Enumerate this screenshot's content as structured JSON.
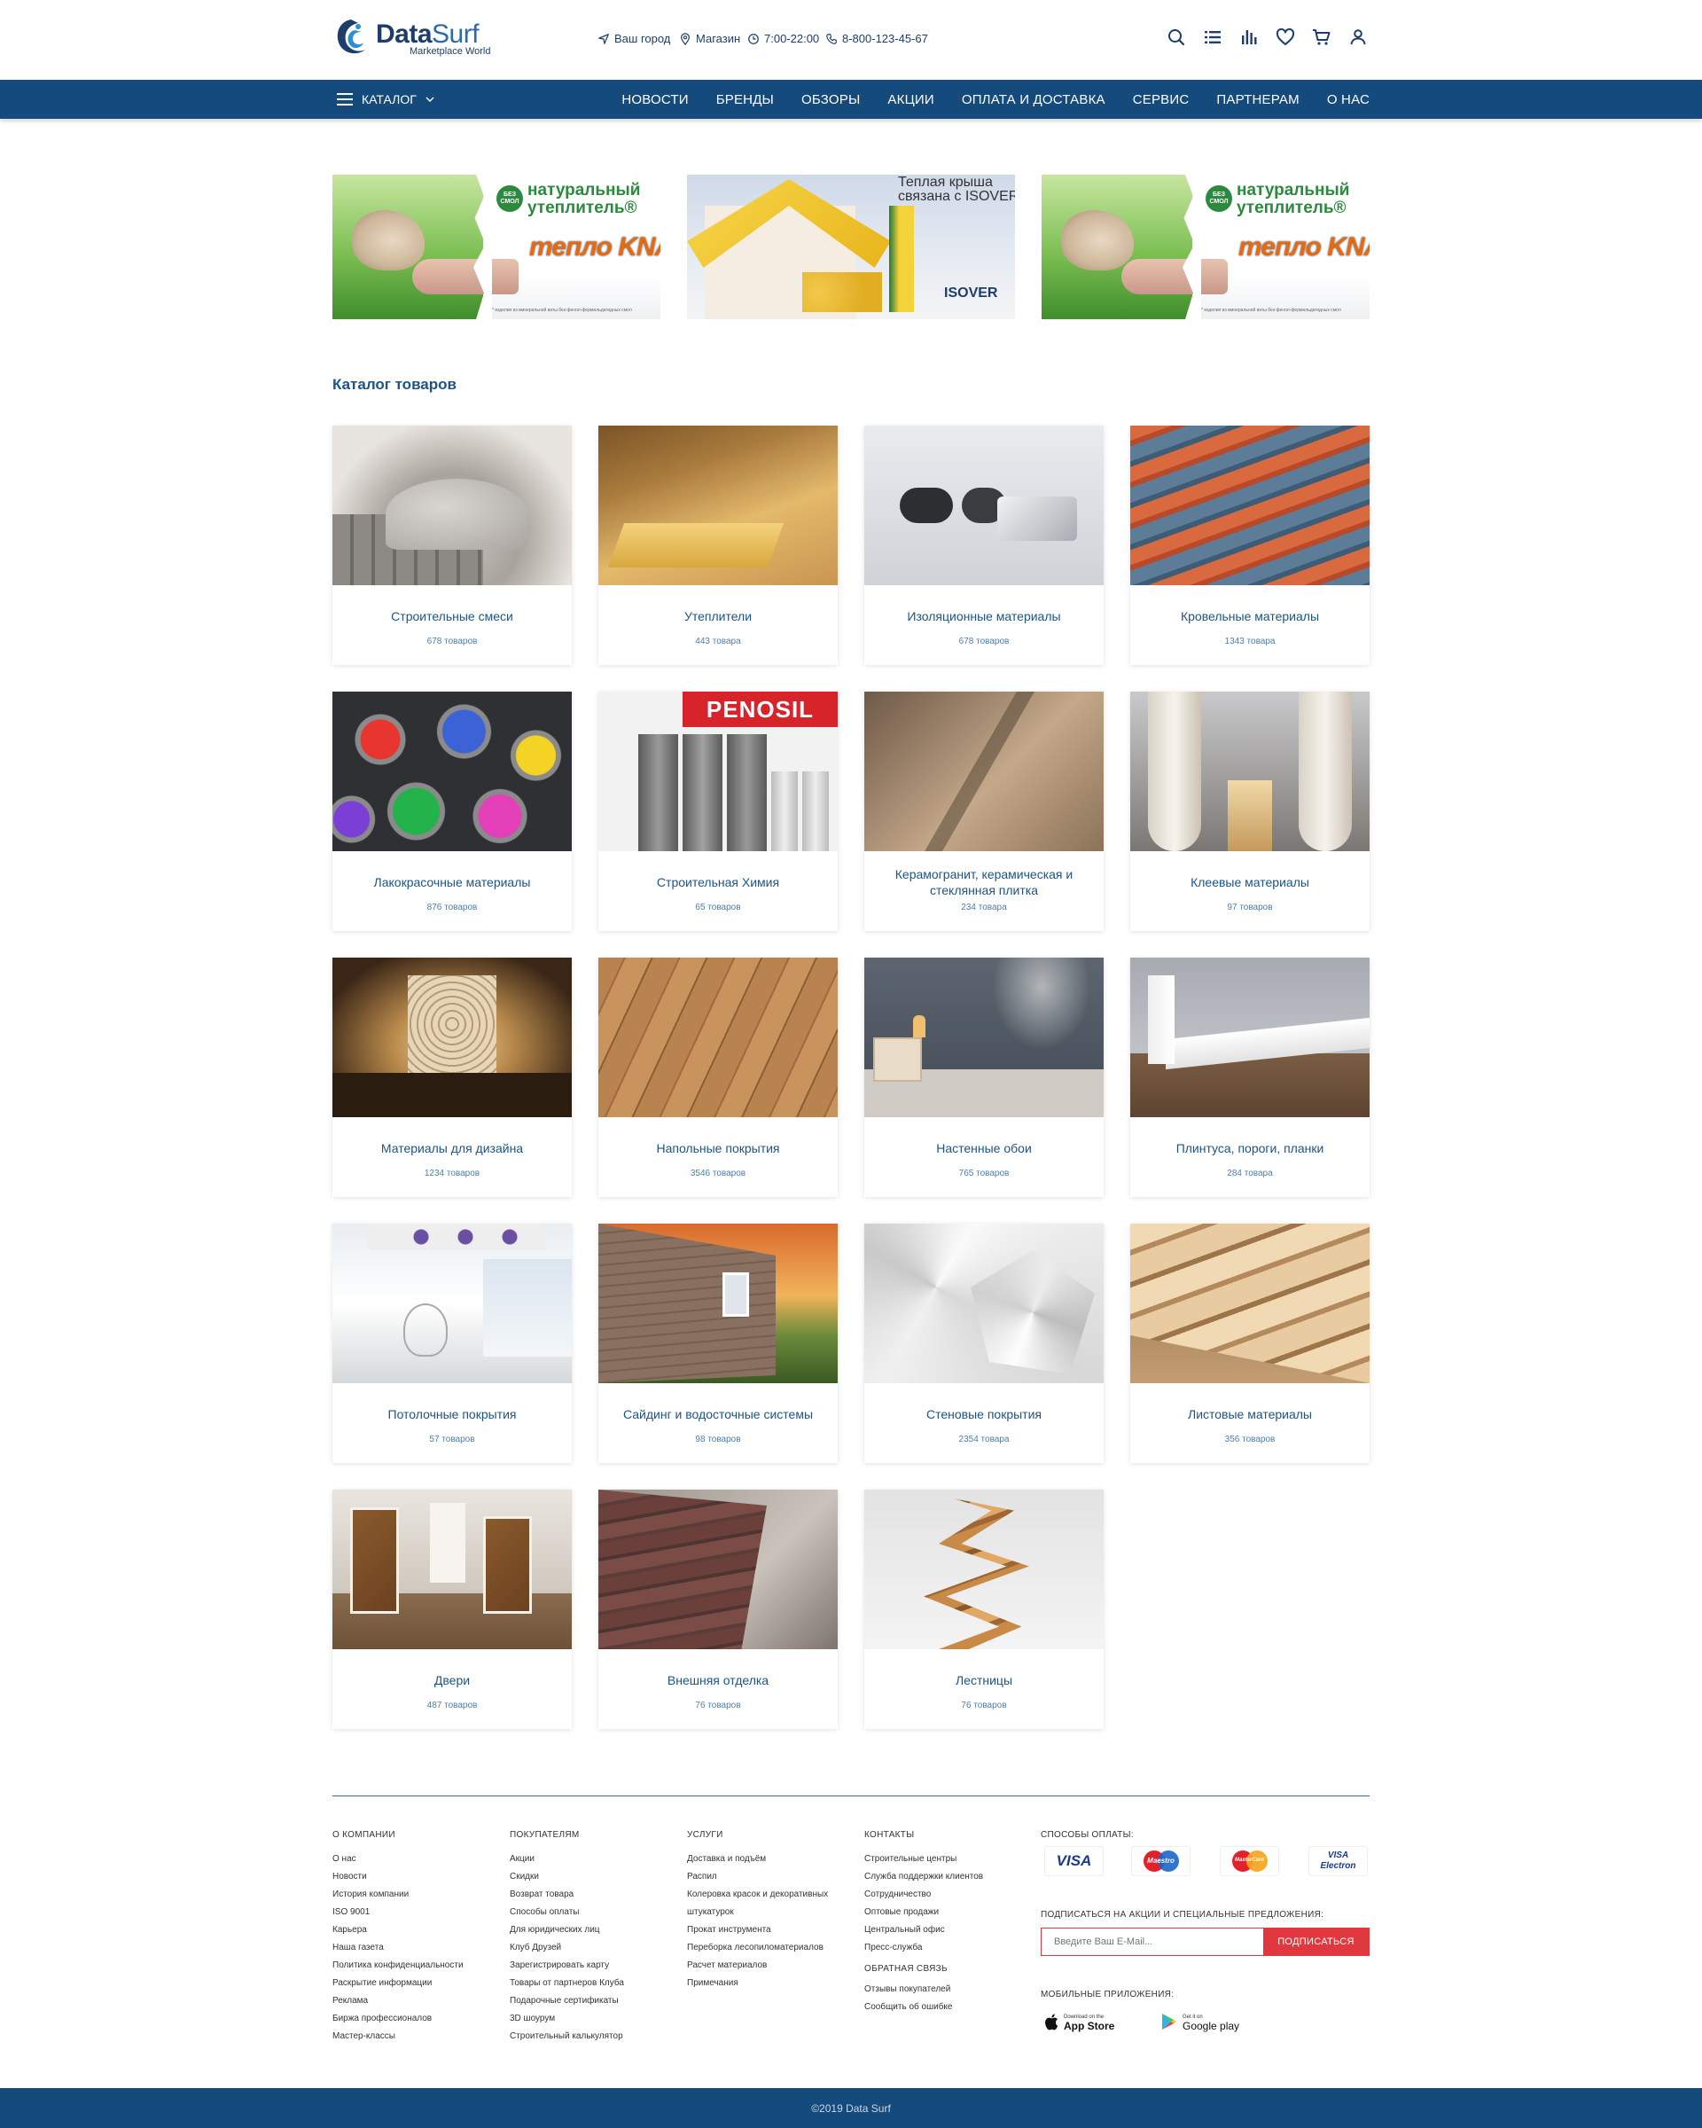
{
  "header": {
    "logo_name_bold": "Data",
    "logo_name_light": "Surf",
    "logo_tagline": "Marketplace World",
    "city": "Ваш город",
    "store": "Магазин",
    "hours": "7:00-22:00",
    "phone": "8-800-123-45-67",
    "icons": [
      "search-icon",
      "list-icon",
      "compare-icon",
      "heart-icon",
      "cart-icon",
      "user-icon"
    ]
  },
  "nav": {
    "catalog_label": "КАТАЛОГ",
    "items": [
      "НОВОСТИ",
      "БРЕНДЫ",
      "ОБЗОРЫ",
      "АКЦИИ",
      "ОПЛАТА И ДОСТАВКА",
      "СЕРВИС",
      "ПАРТНЕРАМ",
      "О НАС"
    ]
  },
  "banners": [
    {
      "badge": "БЕЗ СМОЛ",
      "headline_1": "натуральный",
      "headline_2": "утеплитель®",
      "brand": "тепло KNAUF",
      "fine": "* изделия из минеральной ваты без фенол-формальдегидных смол"
    },
    {
      "headline_1": "Теплая крыша",
      "headline_2": "связана с ISOVER",
      "brand": "ISOVER"
    },
    {
      "badge": "БЕЗ СМОЛ",
      "headline_1": "натуральный",
      "headline_2": "утеплитель®",
      "brand": "тепло KNAUF",
      "fine": "* изделия из минеральной ваты без фенол-формальдегидных смол"
    }
  ],
  "catalog": {
    "title": "Каталог товаров",
    "items": [
      {
        "name": "Строительные смеси",
        "count": "678 товаров"
      },
      {
        "name": "Утеплители",
        "count": "443 товара"
      },
      {
        "name": "Изоляционные материалы",
        "count": "678 товаров"
      },
      {
        "name": "Кровельные материалы",
        "count": "1343 товара"
      },
      {
        "name": "Лакокрасочные материалы",
        "count": "876 товаров"
      },
      {
        "name": "Строительная Химия",
        "count": "65 товаров"
      },
      {
        "name": "Керамогранит, керамическая и стеклянная плитка",
        "count": "234 товара"
      },
      {
        "name": "Клеевые материалы",
        "count": "97 товаров"
      },
      {
        "name": "Материалы для дизайна",
        "count": "1234 товаров"
      },
      {
        "name": "Напольные покрытия",
        "count": "3546 товаров"
      },
      {
        "name": "Настенные обои",
        "count": "765 товаров"
      },
      {
        "name": "Плинтуса, пороги, планки",
        "count": "284 товара"
      },
      {
        "name": "Потолочные покрытия",
        "count": "57 товаров"
      },
      {
        "name": "Сайдинг и водосточные системы",
        "count": "98 товаров"
      },
      {
        "name": "Стеновые покрытия",
        "count": "2354 товара"
      },
      {
        "name": "Листовые материалы",
        "count": "356 товаров"
      },
      {
        "name": "Двери",
        "count": "487 товаров"
      },
      {
        "name": "Внешняя отделка",
        "count": "76 товаров"
      },
      {
        "name": "Лестницы",
        "count": "76 товаров"
      }
    ]
  },
  "footer": {
    "about": {
      "title": "О КОМПАНИИ",
      "links": [
        "О нас",
        "Новости",
        "История компании",
        "ISO 9001",
        "Карьера",
        "Наша газета",
        "Политика конфиденциальности",
        "Раскрытие информации",
        "Реклама",
        "Биржа профессионалов",
        "Мастер-классы"
      ]
    },
    "buyers": {
      "title": "ПОКУПАТЕЛЯМ",
      "links": [
        "Акции",
        "Скидки",
        "Возврат товара",
        "Способы оплаты",
        "Для юридических лиц",
        "Клуб Друзей",
        "Зарегистрировать карту",
        "Товары от партнеров Клуба",
        "Подарочные сертификаты",
        "3D шоурум",
        "Строительный калькулятор"
      ]
    },
    "services": {
      "title": "УСЛУГИ",
      "links": [
        "Доставка и подъём",
        "Распил",
        "Колеровка красок и  декоративных",
        "штукатурок",
        "Прокат инструмента",
        "Переборка лесопиломатериалов",
        "Расчет материалов",
        "Примечания"
      ]
    },
    "contacts": {
      "title": "КОНТАКТЫ",
      "links": [
        "Строительные центры",
        "Служба поддержки клиентов",
        "Сотрудничество",
        "Оптовые продажи",
        "Центральный офис",
        "Пресс-служба"
      ],
      "feedback_title": "ОБРАТНАЯ СВЯЗЬ",
      "feedback_links": [
        "Отзывы покупателей",
        "Сообщить об ошибке"
      ]
    },
    "payment_title": "СПОСОБЫ ОПЛАТЫ:",
    "payment_methods": [
      "VISA",
      "Maestro",
      "MasterCard",
      "VISA Electron"
    ],
    "subscribe_title": "ПОДПИСАТЬСЯ НА АКЦИИ И СПЕЦИАЛЬНЫЕ ПРЕДЛОЖЕНИЯ:",
    "subscribe_placeholder": "Введите Ваш E-Mail...",
    "subscribe_button": "ПОДПИСАТЬСЯ",
    "apps_title": "МОБИЛЬНЫЕ ПРИЛОЖЕНИЯ:",
    "appstore_small": "Download on the",
    "appstore_big": "App Store",
    "googleplay_small": "Get it on",
    "googleplay_big": "Google play",
    "copyright": "©2019  Data Surf"
  },
  "colors": {
    "nav_bg": "#154a7c",
    "accent": "#1d5486",
    "subscribe": "#e0383e"
  }
}
